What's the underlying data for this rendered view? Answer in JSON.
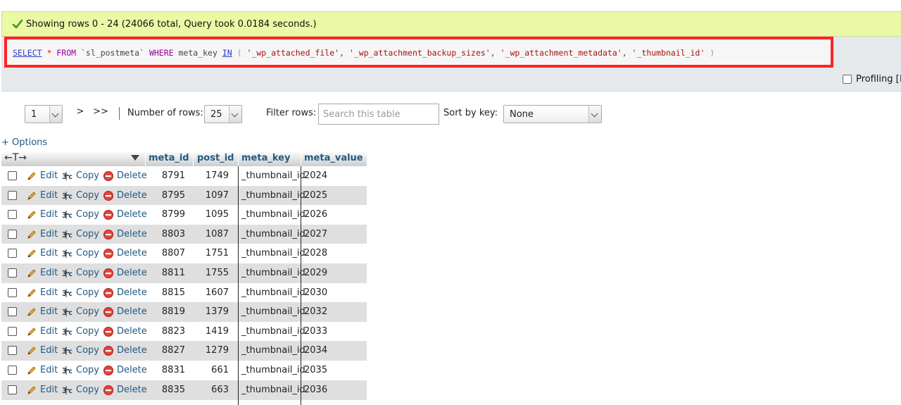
{
  "message": {
    "text": "Showing rows 0 - 24 (24066 total, Query took 0.0184 seconds.)"
  },
  "sql": {
    "select_kw": "SELECT",
    "star": "*",
    "from_kw": "FROM",
    "table": "`sl_postmeta`",
    "where_kw": "WHERE",
    "column": "meta_key",
    "in_kw": "IN",
    "open_paren": "(",
    "values": [
      "'_wp_attached_file'",
      "'_wp_attachment_backup_sizes'",
      "'_wp_attachment_metadata'",
      "'_thumbnail_id'"
    ],
    "close_paren": ")"
  },
  "profiling": {
    "label": "Profiling [",
    "link": "E"
  },
  "navigation": {
    "page_select_value": "1",
    "next_label": ">",
    "last_label": ">>",
    "rows_label": "Number of rows:",
    "rows_value": "25",
    "filter_label": "Filter rows:",
    "filter_placeholder": "Search this table",
    "sort_label": "Sort by key:",
    "sort_value": "None"
  },
  "options_link": "+ Options",
  "table": {
    "arrows_label": "←T→",
    "columns": [
      "meta_id",
      "post_id",
      "meta_key",
      "meta_value"
    ],
    "actions": {
      "edit": "Edit",
      "copy": "Copy",
      "delete": "Delete"
    },
    "rows": [
      [
        "8791",
        "1749",
        "_thumbnail_id",
        "2024"
      ],
      [
        "8795",
        "1097",
        "_thumbnail_id",
        "2025"
      ],
      [
        "8799",
        "1095",
        "_thumbnail_id",
        "2026"
      ],
      [
        "8803",
        "1087",
        "_thumbnail_id",
        "2027"
      ],
      [
        "8807",
        "1751",
        "_thumbnail_id",
        "2028"
      ],
      [
        "8811",
        "1755",
        "_thumbnail_id",
        "2029"
      ],
      [
        "8815",
        "1607",
        "_thumbnail_id",
        "2030"
      ],
      [
        "8819",
        "1379",
        "_thumbnail_id",
        "2032"
      ],
      [
        "8823",
        "1419",
        "_thumbnail_id",
        "2033"
      ],
      [
        "8827",
        "1279",
        "_thumbnail_id",
        "2034"
      ],
      [
        "8831",
        "661",
        "_thumbnail_id",
        "2035"
      ],
      [
        "8835",
        "663",
        "_thumbnail_id",
        "2036"
      ]
    ]
  },
  "icons": {
    "success": "check-icon",
    "edit": "pencil-icon",
    "copy": "copy-icon",
    "delete": "delete-icon"
  },
  "colors": {
    "success_bg": "#ebf8a4",
    "sql_border": "#ff2424",
    "link": "#235a81",
    "row_alt": "#dfdfdf"
  }
}
